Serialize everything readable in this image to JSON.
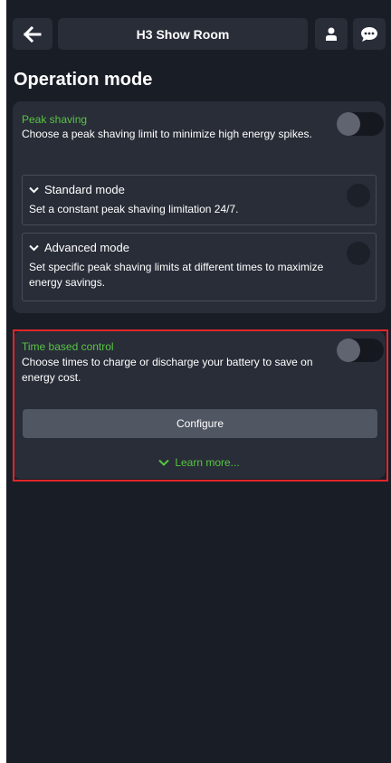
{
  "header": {
    "title": "H3 Show Room",
    "back_icon": "arrow-left-icon",
    "user_icon": "user-icon",
    "chat_icon": "chat-bubble-icon"
  },
  "page": {
    "title": "Operation mode"
  },
  "peak_shaving": {
    "label": "Peak shaving",
    "description": "Choose a peak shaving limit to minimize high energy spikes.",
    "enabled": false,
    "modes": [
      {
        "title": "Standard mode",
        "description": "Set a constant peak shaving limitation 24/7.",
        "selected": false
      },
      {
        "title": "Advanced mode",
        "description": "Set specific peak shaving limits at different times to maximize energy savings.",
        "selected": false
      }
    ]
  },
  "time_based_control": {
    "label": "Time based control",
    "description": "Choose times to charge or discharge your battery to save on energy cost.",
    "enabled": false,
    "configure_label": "Configure",
    "learn_more_label": "Learn more..."
  },
  "colors": {
    "background": "#191d26",
    "card": "#282d38",
    "accent_green": "#58c542",
    "highlight_red": "#e0262a"
  }
}
